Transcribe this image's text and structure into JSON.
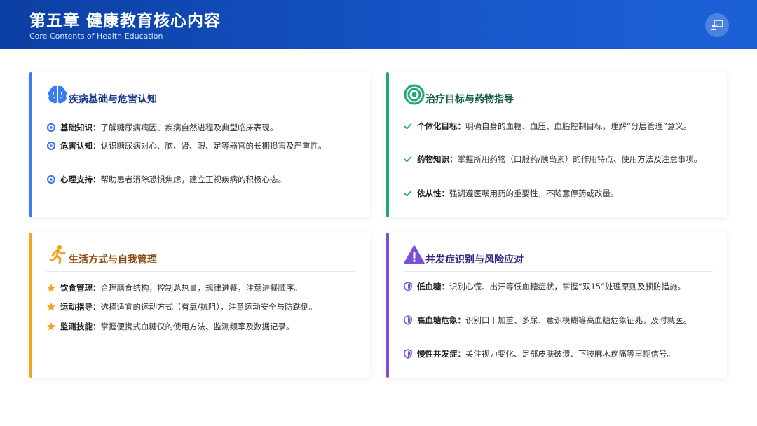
{
  "header": {
    "title": "第五章 健康教育核心内容",
    "subtitle": "Core Contents of Health Education",
    "button_icon": "presentation-icon"
  },
  "colors": {
    "header": "#1656c9",
    "blue": "#3b7cf3",
    "green": "#1fa971",
    "orange": "#f2a321",
    "purple": "#7b4fd6"
  },
  "cards": [
    {
      "title": "疾病基础与危害认知",
      "icon": "brain-icon",
      "items": [
        {
          "label": "基础知识：",
          "text": "了解糖尿病病因、疾病自然进程及典型临床表现。"
        },
        {
          "label": "危害认知：",
          "text": "认识糖尿病对心、脑、肾、眼、足等器官的长期损害及严重性。"
        },
        {
          "label": "心理支持：",
          "text": "帮助患者消除恐惧焦虑，建立正视疾病的积极心态。"
        }
      ]
    },
    {
      "title": "治疗目标与药物指导",
      "icon": "target-icon",
      "items": [
        {
          "label": "个体化目标：",
          "text": "明确自身的血糖、血压、血脂控制目标，理解“分层管理”意义。"
        },
        {
          "label": "药物知识：",
          "text": "掌握所用药物（口服药/胰岛素）的作用特点、使用方法及注意事项。"
        },
        {
          "label": "依从性：",
          "text": "强调遵医嘱用药的重要性，不随意停药或改量。"
        }
      ]
    },
    {
      "title": "生活方式与自我管理",
      "icon": "running-icon",
      "items": [
        {
          "label": "饮食管理：",
          "text": "合理膳食结构，控制总热量，规律进餐，注意进餐顺序。"
        },
        {
          "label": "运动指导：",
          "text": "选择适宜的运动方式（有氧/抗阻），注意运动安全与防跌倒。"
        },
        {
          "label": "监测技能：",
          "text": "掌握便携式血糖仪的使用方法、监测频率及数据记录。"
        }
      ]
    },
    {
      "title": "并发症识别与风险应对",
      "icon": "warning-icon",
      "items": [
        {
          "label": "低血糖：",
          "text": "识别心慌、出汗等低血糖症状，掌握“双15”处理原则及预防措施。"
        },
        {
          "label": "高血糖危象：",
          "text": "识别口干加重、多尿、意识模糊等高血糖危象征兆，及时就医。"
        },
        {
          "label": "慢性并发症：",
          "text": "关注视力变化、足部皮肤破溃、下肢麻木疼痛等早期信号。"
        }
      ]
    }
  ]
}
